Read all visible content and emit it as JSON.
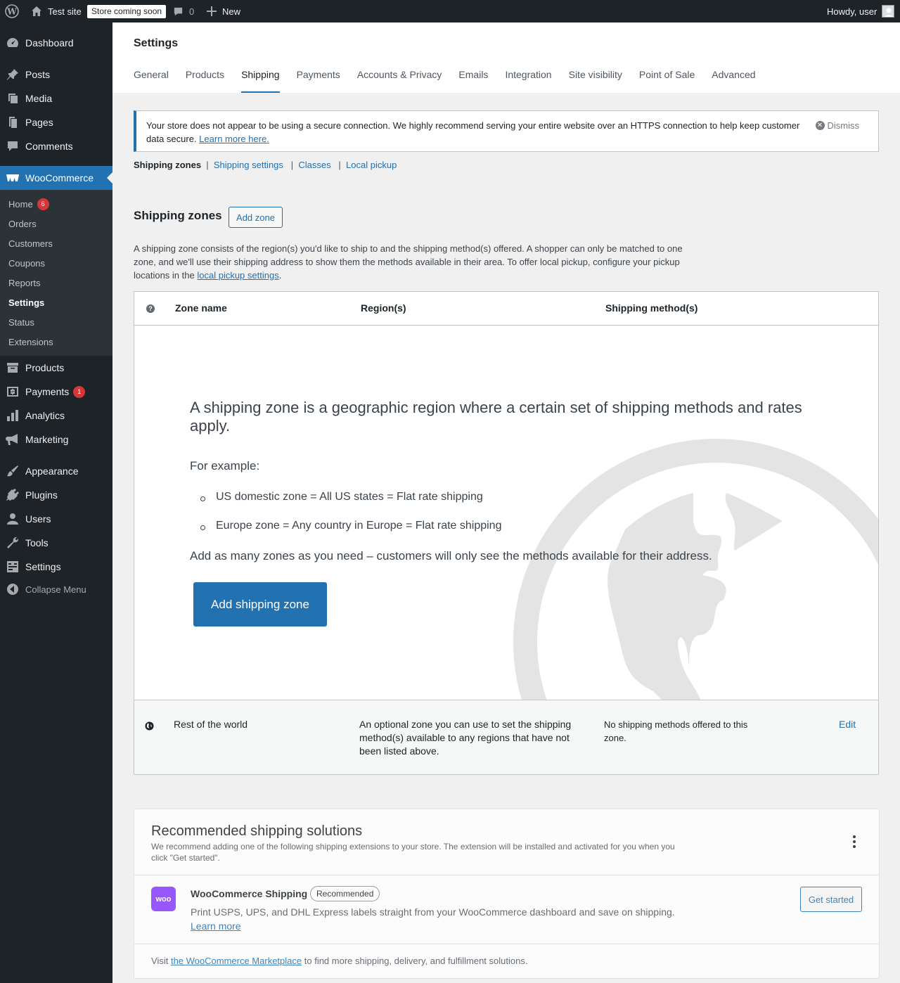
{
  "adminbar": {
    "site_name": "Test site",
    "store_status": "Store coming soon",
    "comments_count": "0",
    "new_label": "New",
    "greeting": "Howdy, user"
  },
  "sidebar": {
    "top_items": [
      {
        "label": "Dashboard",
        "icon": "dashboard-icon"
      },
      {
        "label": "Posts",
        "icon": "pin-icon"
      },
      {
        "label": "Media",
        "icon": "media-icon"
      },
      {
        "label": "Pages",
        "icon": "pages-icon"
      },
      {
        "label": "Comments",
        "icon": "comment-icon"
      }
    ],
    "woocommerce": {
      "label": "WooCommerce",
      "icon": "woo-icon"
    },
    "sub_items": [
      {
        "label": "Home",
        "badge": "6"
      },
      {
        "label": "Orders"
      },
      {
        "label": "Customers"
      },
      {
        "label": "Coupons"
      },
      {
        "label": "Reports"
      },
      {
        "label": "Settings"
      },
      {
        "label": "Status"
      },
      {
        "label": "Extensions"
      }
    ],
    "bottom_items": [
      {
        "label": "Products",
        "icon": "archive-icon"
      },
      {
        "label": "Payments",
        "icon": "money-icon",
        "badge": "1"
      },
      {
        "label": "Analytics",
        "icon": "chart-icon"
      },
      {
        "label": "Marketing",
        "icon": "megaphone-icon"
      },
      {
        "label": "Appearance",
        "icon": "brush-icon"
      },
      {
        "label": "Plugins",
        "icon": "plug-icon"
      },
      {
        "label": "Users",
        "icon": "user-icon"
      },
      {
        "label": "Tools",
        "icon": "wrench-icon"
      },
      {
        "label": "Settings",
        "icon": "settings-icon"
      }
    ],
    "collapse_label": "Collapse Menu"
  },
  "header": {
    "title": "Settings",
    "tabs": [
      "General",
      "Products",
      "Shipping",
      "Payments",
      "Accounts & Privacy",
      "Emails",
      "Integration",
      "Site visibility",
      "Point of Sale",
      "Advanced"
    ],
    "active_tab": "Shipping"
  },
  "notice": {
    "text": "Your store does not appear to be using a secure connection. We highly recommend serving your entire website over an HTTPS connection to help keep customer data secure.",
    "link": "Learn more here.",
    "dismiss": "Dismiss"
  },
  "subnav": {
    "current": "Shipping zones",
    "links": [
      "Shipping settings",
      "Classes",
      "Local pickup"
    ]
  },
  "zones": {
    "title": "Shipping zones",
    "add_zone": "Add zone",
    "description": "A shipping zone consists of the region(s) you'd like to ship to and the shipping method(s) offered. A shopper can only be matched to one zone, and we'll use their shipping address to show them the methods available in their area. To offer local pickup, configure your pickup locations in the",
    "description_link": "local pickup settings",
    "description_end": ".",
    "columns": {
      "name": "Zone name",
      "regions": "Region(s)",
      "methods": "Shipping method(s)"
    },
    "blank": {
      "heading": "A shipping zone is a geographic region where a certain set of shipping methods and rates apply.",
      "example_label": "For example:",
      "examples": [
        "US domestic zone = All US states = Flat rate shipping",
        "Europe zone = Any country in Europe = Flat rate shipping"
      ],
      "footer": "Add as many zones as you need – customers will only see the methods available for their address.",
      "button": "Add shipping zone"
    },
    "rest_of_world": {
      "name": "Rest of the world",
      "region": "An optional zone you can use to set the shipping method(s) available to any regions that have not been listed above.",
      "methods": "No shipping methods offered to this zone.",
      "edit": "Edit"
    }
  },
  "recommended": {
    "title": "Recommended shipping solutions",
    "description": "We recommend adding one of the following shipping extensions to your store. The extension will be installed and activated for you when you click \"Get started\".",
    "item": {
      "logo_text": "woo",
      "name": "WooCommerce Shipping",
      "badge": "Recommended",
      "description": "Print USPS, UPS, and DHL Express labels straight from your WooCommerce dashboard and save on shipping.",
      "learn_more": "Learn more",
      "button": "Get started"
    },
    "footer_prefix": "Visit",
    "footer_link": "the WooCommerce Marketplace",
    "footer_suffix": "to find more shipping, delivery, and fulfillment solutions."
  }
}
